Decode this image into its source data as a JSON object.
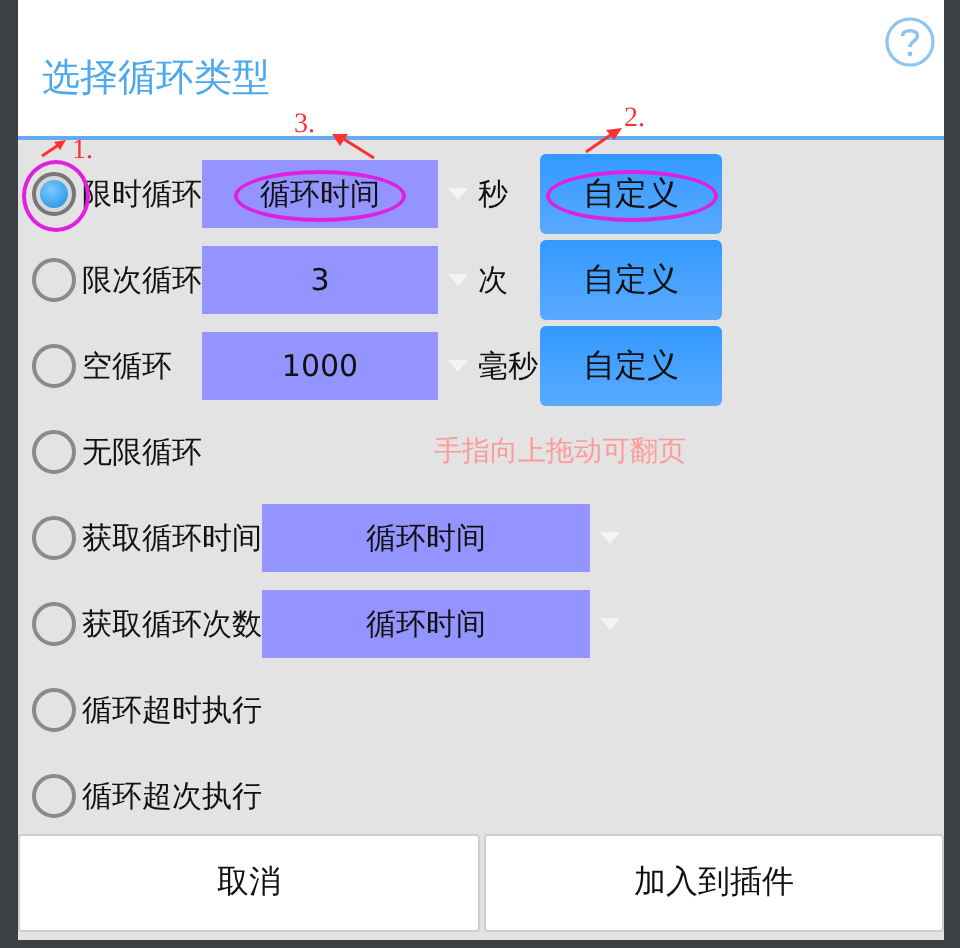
{
  "dialog": {
    "title": "选择循环类型"
  },
  "rows": [
    {
      "kind": "timed",
      "label": "限时循环",
      "selected": true,
      "value": "循环时间",
      "unit": "秒",
      "button": "自定义",
      "radio_note": "1.",
      "button_note": "2.",
      "value_note": "3."
    },
    {
      "kind": "timed",
      "label": "限次循环",
      "selected": false,
      "value": "3",
      "unit": "次",
      "button": "自定义"
    },
    {
      "kind": "timed",
      "label": "空循环",
      "selected": false,
      "value": "1000",
      "unit": "毫秒",
      "button": "自定义"
    },
    {
      "kind": "plain",
      "label": "无限循环",
      "selected": false,
      "hint": "手指向上拖动可翻页"
    },
    {
      "kind": "getter",
      "label": "获取循环时间",
      "selected": false,
      "value": "循环时间"
    },
    {
      "kind": "getter",
      "label": "获取循环次数",
      "selected": false,
      "value": "循环时间"
    },
    {
      "kind": "plain",
      "label": "循环超时执行",
      "selected": false
    },
    {
      "kind": "plain",
      "label": "循环超次执行",
      "selected": false
    }
  ],
  "buttons": [
    "取消",
    "加入到插件"
  ]
}
